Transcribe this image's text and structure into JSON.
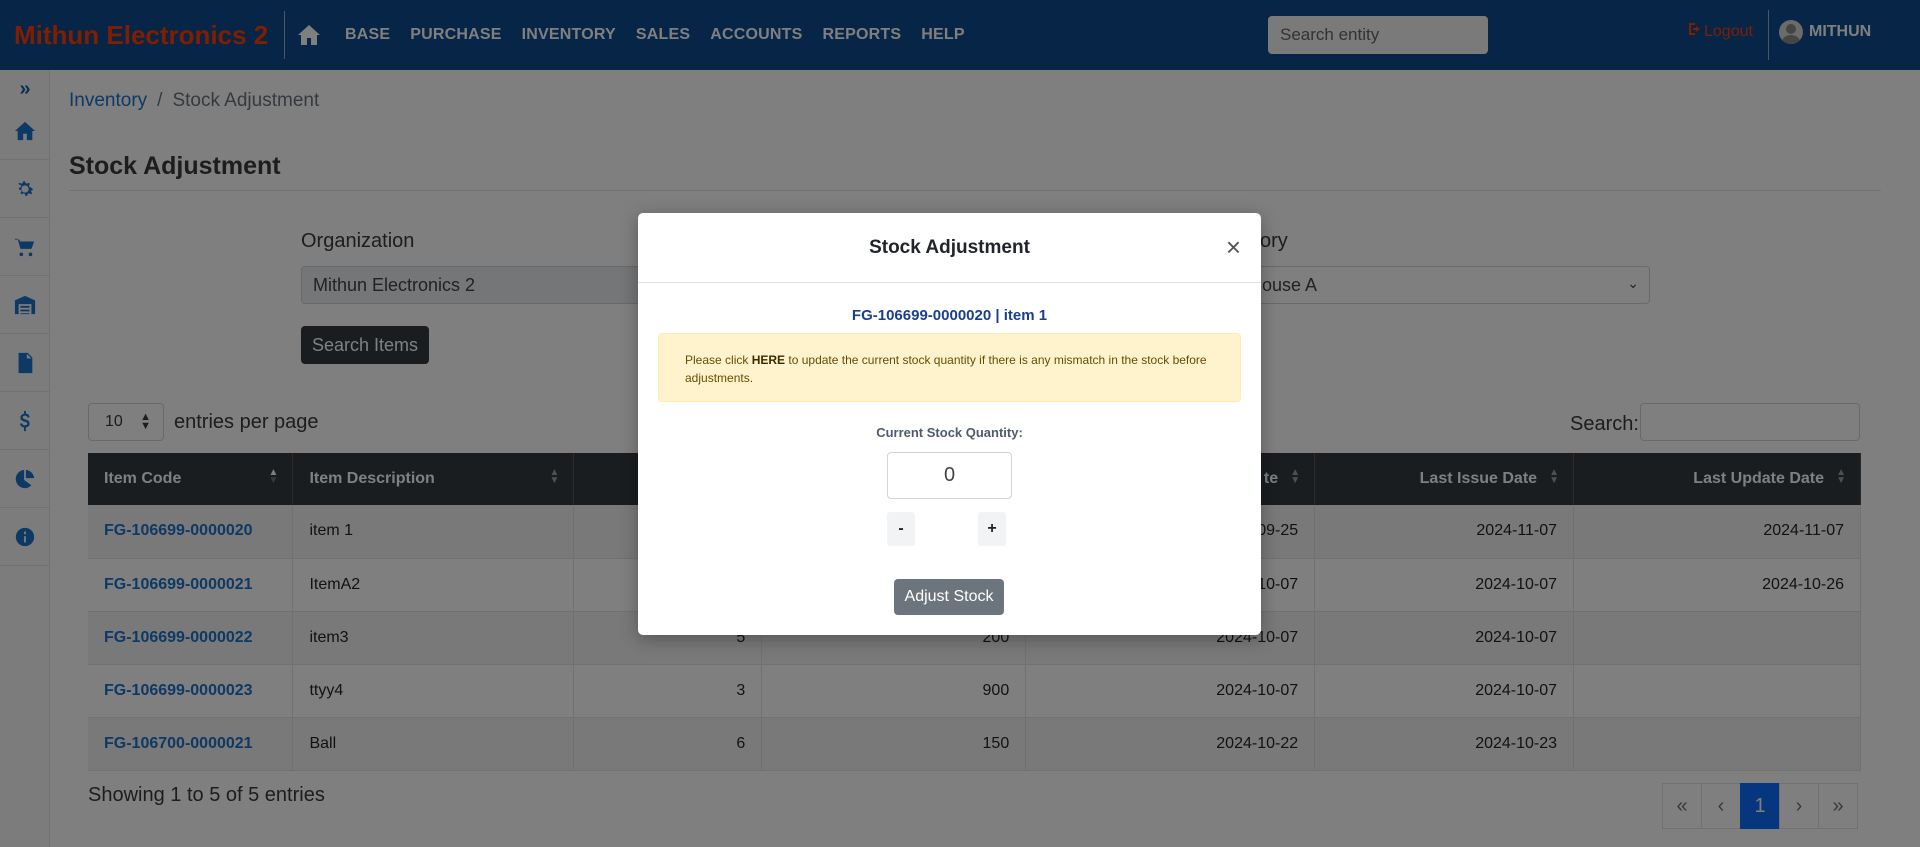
{
  "app": {
    "brand": "Mithun Electronics 2",
    "nav_items": [
      "BASE",
      "PURCHASE",
      "INVENTORY",
      "SALES",
      "ACCOUNTS",
      "REPORTS",
      "HELP"
    ],
    "search_placeholder": "Search entity",
    "logout_label": "Logout",
    "user_name": "MITHUN"
  },
  "colors": {
    "navbar": "#0d4b8f",
    "brand": "#ff3c00",
    "link": "#1a73c9",
    "table_header": "#343a40",
    "pager_active": "#0d6efd",
    "alert_bg": "#fff3cd"
  },
  "sidebar": {
    "icons": [
      "chevrons-right-icon",
      "home-icon",
      "gear-icon",
      "cart-icon",
      "warehouse-icon",
      "invoice-icon",
      "dollar-icon",
      "pie-chart-icon",
      "info-icon"
    ]
  },
  "breadcrumb": {
    "parent": "Inventory",
    "current": "Stock Adjustment"
  },
  "page": {
    "title": "Stock Adjustment",
    "organization_label": "Organization",
    "organization_value": "Mithun Electronics 2",
    "inventory_label": "ory",
    "inventory_value": "ehouse A",
    "search_button": "Search Items",
    "entries_value": "10",
    "entries_label": "entries per page",
    "search_label": "Search:",
    "showing": "Showing 1 to 5 of 5 entries",
    "pager": [
      "«",
      "‹",
      "1",
      "›",
      "»"
    ]
  },
  "table": {
    "headers": [
      "Item Code",
      "Item Description",
      "",
      "",
      "te",
      "Last Issue Date",
      "Last Update Date"
    ],
    "rows": [
      [
        "FG-106699-0000020",
        "item 1",
        "",
        "",
        "09-25",
        "2024-11-07",
        "2024-11-07"
      ],
      [
        "FG-106699-0000021",
        "ItemA2",
        "",
        "",
        "10-07",
        "2024-10-07",
        "2024-10-26"
      ],
      [
        "FG-106699-0000022",
        "item3",
        "5",
        "200",
        "2024-10-07",
        "2024-10-07",
        ""
      ],
      [
        "FG-106699-0000023",
        "ttyy4",
        "3",
        "900",
        "2024-10-07",
        "2024-10-07",
        ""
      ],
      [
        "FG-106700-0000021",
        "Ball",
        "6",
        "150",
        "2024-10-22",
        "2024-10-23",
        ""
      ]
    ]
  },
  "modal": {
    "title": "Stock Adjustment",
    "close": "×",
    "item": "FG-106699-0000020 | item 1",
    "alert_prefix": "Please click ",
    "alert_link": "HERE",
    "alert_suffix": " to update the current stock quantity if there is any mismatch in the stock before adjustments.",
    "qty_label": "Current Stock Quantity:",
    "qty_value": "0",
    "minus": "-",
    "plus": "+",
    "adjust_button": "Adjust Stock"
  }
}
